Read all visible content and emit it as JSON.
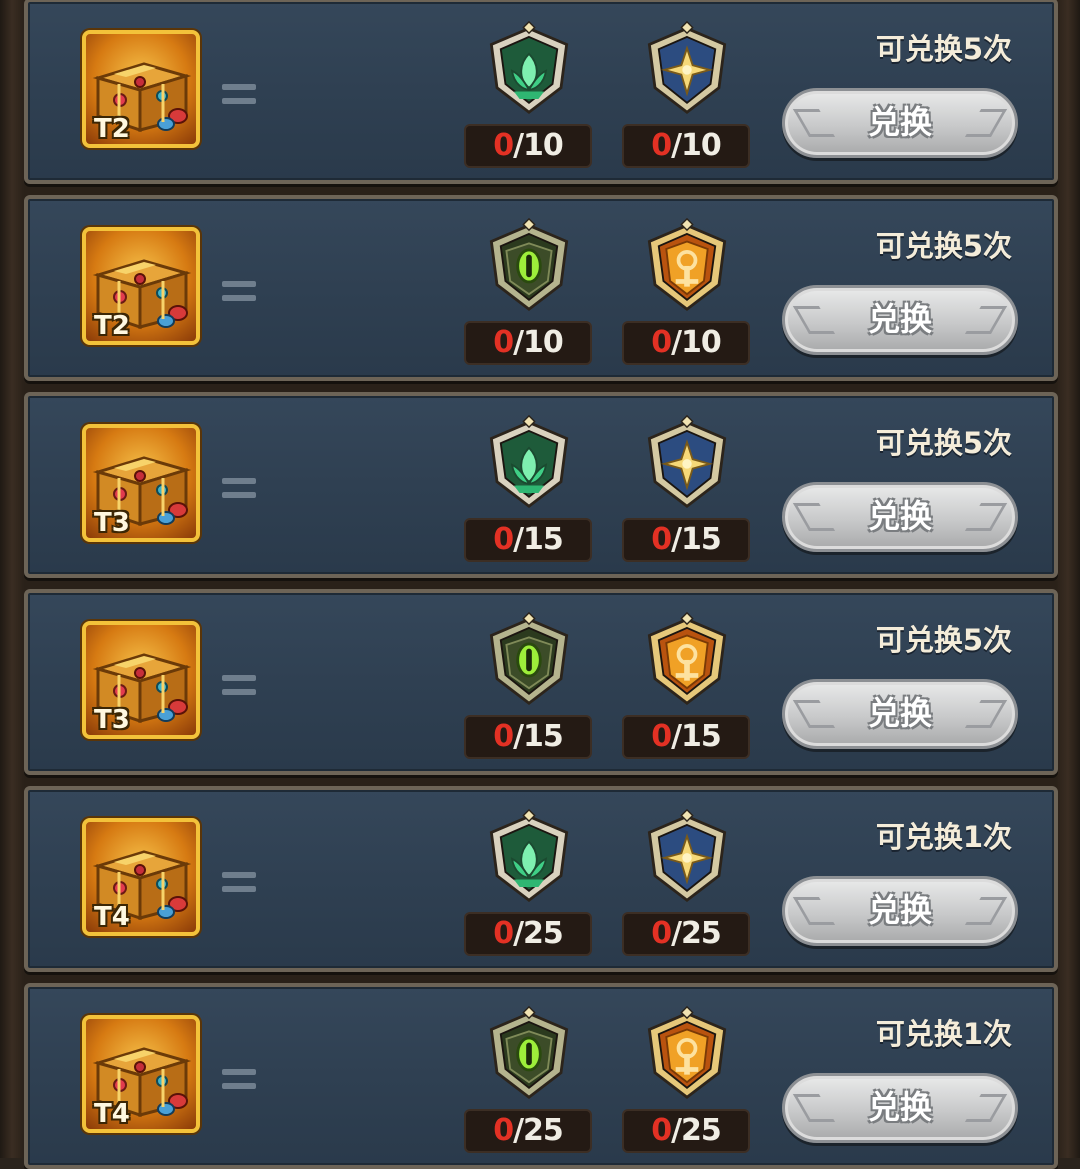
{
  "colors": {
    "row_bg": "#2f4052",
    "count_have": "#e33124",
    "button_bg": "#c8c9ca",
    "chest_frame": "#f3c23a"
  },
  "exchange_list": [
    {
      "chest": {
        "tier": "T2",
        "icon": "treasure-chest-icon"
      },
      "materials": [
        {
          "icon": "green-lotus-emblem-icon",
          "have": "0",
          "need": "/10"
        },
        {
          "icon": "blue-star-emblem-icon",
          "have": "0",
          "need": "/10"
        }
      ],
      "limit": "可兑换5次",
      "button": "兑换"
    },
    {
      "chest": {
        "tier": "T2",
        "icon": "treasure-chest-icon"
      },
      "materials": [
        {
          "icon": "green-eye-emblem-icon",
          "have": "0",
          "need": "/10"
        },
        {
          "icon": "orange-crest-emblem-icon",
          "have": "0",
          "need": "/10"
        }
      ],
      "limit": "可兑换5次",
      "button": "兑换"
    },
    {
      "chest": {
        "tier": "T3",
        "icon": "treasure-chest-icon"
      },
      "materials": [
        {
          "icon": "green-lotus-emblem-icon",
          "have": "0",
          "need": "/15"
        },
        {
          "icon": "blue-star-emblem-icon",
          "have": "0",
          "need": "/15"
        }
      ],
      "limit": "可兑换5次",
      "button": "兑换"
    },
    {
      "chest": {
        "tier": "T3",
        "icon": "treasure-chest-icon"
      },
      "materials": [
        {
          "icon": "green-eye-emblem-icon",
          "have": "0",
          "need": "/15"
        },
        {
          "icon": "orange-crest-emblem-icon",
          "have": "0",
          "need": "/15"
        }
      ],
      "limit": "可兑换5次",
      "button": "兑换"
    },
    {
      "chest": {
        "tier": "T4",
        "icon": "treasure-chest-icon"
      },
      "materials": [
        {
          "icon": "green-lotus-emblem-icon",
          "have": "0",
          "need": "/25"
        },
        {
          "icon": "blue-star-emblem-icon",
          "have": "0",
          "need": "/25"
        }
      ],
      "limit": "可兑换1次",
      "button": "兑换"
    },
    {
      "chest": {
        "tier": "T4",
        "icon": "treasure-chest-icon"
      },
      "materials": [
        {
          "icon": "green-eye-emblem-icon",
          "have": "0",
          "need": "/25"
        },
        {
          "icon": "orange-crest-emblem-icon",
          "have": "0",
          "need": "/25"
        }
      ],
      "limit": "可兑换1次",
      "button": "兑换"
    }
  ]
}
